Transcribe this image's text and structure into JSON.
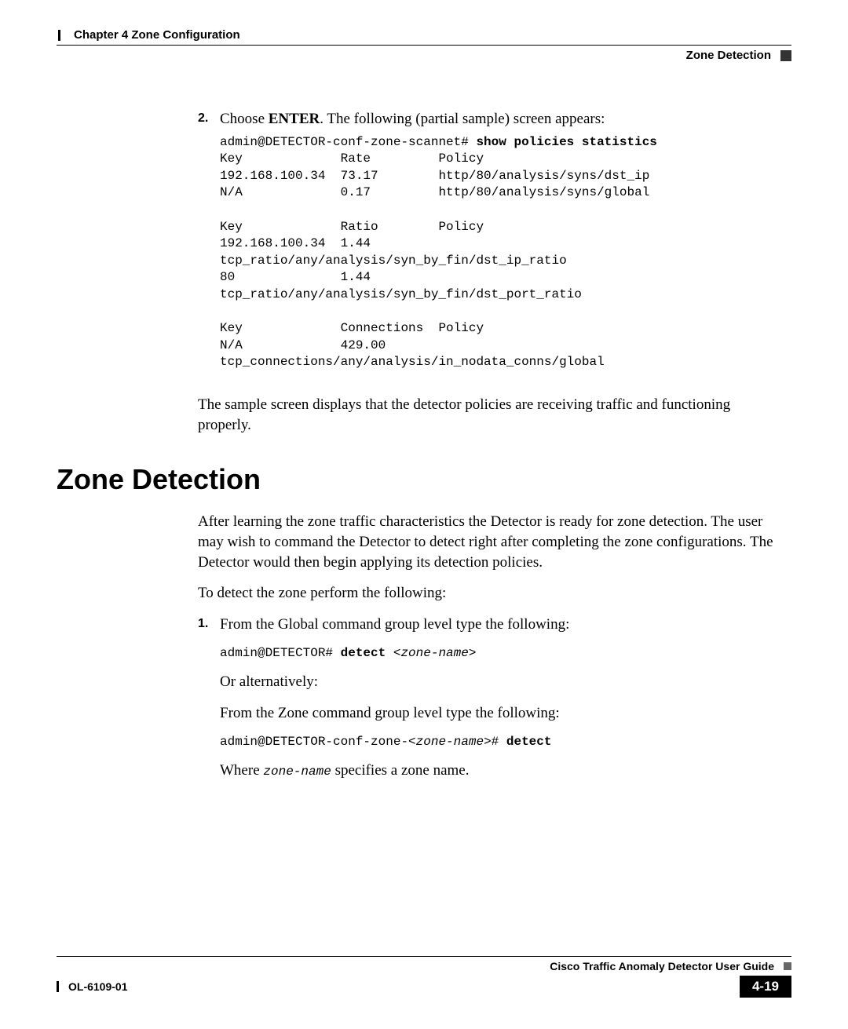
{
  "header": {
    "chapter": "Chapter 4    Zone Configuration",
    "section": "Zone Detection"
  },
  "step2": {
    "num": "2.",
    "lead_pre": "Choose ",
    "lead_bold": "ENTER",
    "lead_post": ". The following (partial sample) screen appears:",
    "code_prompt": "admin@DETECTOR-conf-zone-scannet# ",
    "code_cmd": "show policies statistics",
    "code_body": "Key             Rate         Policy\n192.168.100.34  73.17        http/80/analysis/syns/dst_ip\nN/A             0.17         http/80/analysis/syns/global\n\nKey             Ratio        Policy\n192.168.100.34  1.44         \ntcp_ratio/any/analysis/syn_by_fin/dst_ip_ratio\n80              1.44         \ntcp_ratio/any/analysis/syn_by_fin/dst_port_ratio\n\nKey             Connections  Policy\nN/A             429.00       \ntcp_connections/any/analysis/in_nodata_conns/global",
    "after": "The sample screen displays that the detector policies are receiving traffic and functioning properly."
  },
  "section": {
    "title": "Zone Detection",
    "p1": "After learning the zone traffic characteristics the Detector is ready for zone detection. The user may wish to command the Detector to detect right after completing the zone configurations. The Detector would then begin applying its detection policies.",
    "p2": "To detect the zone perform the following:",
    "step1": {
      "num": "1.",
      "lead": "From the Global command group level type the following:",
      "code1_prompt": "admin@DETECTOR# ",
      "code1_bold": "detect ",
      "code1_ital": "<zone-name>",
      "or": "Or alternatively:",
      "lead2": "From the Zone command group level type the following:",
      "code2_pre": "admin@DETECTOR-conf-zone-<",
      "code2_ital": "zone-name",
      "code2_post": "># ",
      "code2_bold": "detect",
      "where_pre": "Where ",
      "where_ital": "zone-name",
      "where_post": " specifies a zone name."
    }
  },
  "footer": {
    "guide": "Cisco Traffic Anomaly Detector User Guide",
    "doc": "OL-6109-01",
    "page": "4-19"
  }
}
